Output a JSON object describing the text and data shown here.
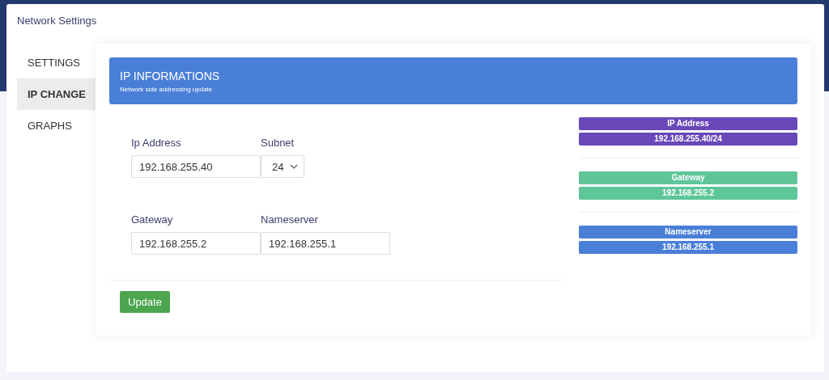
{
  "window": {
    "title": "Network Settings"
  },
  "tabs": [
    {
      "label": "SETTINGS",
      "selected": false
    },
    {
      "label": "IP CHANGE",
      "selected": true
    },
    {
      "label": "GRAPHS",
      "selected": false
    }
  ],
  "header": {
    "title": "IP INFORMATIONS",
    "subtitle": "Network side addressing update"
  },
  "form": {
    "rows": [
      [
        {
          "label": "Ip Address",
          "kind": "input",
          "value": "192.168.255.40"
        },
        {
          "label": "Subnet",
          "kind": "select",
          "value": "24"
        }
      ],
      [
        {
          "label": "Gateway",
          "kind": "input",
          "value": "192.168.255.2"
        },
        {
          "label": "Nameserver",
          "kind": "input",
          "value": "192.168.255.1"
        }
      ]
    ],
    "button": "Update"
  },
  "summary": [
    {
      "label": "IP Address",
      "value": "192.168.255.40/24",
      "color": "#6a48b9"
    },
    {
      "label": "Gateway",
      "value": "192.168.255.2",
      "color": "#5ec699"
    },
    {
      "label": "Nameserver",
      "value": "192.168.255.1",
      "color": "#4a7fd8"
    }
  ]
}
